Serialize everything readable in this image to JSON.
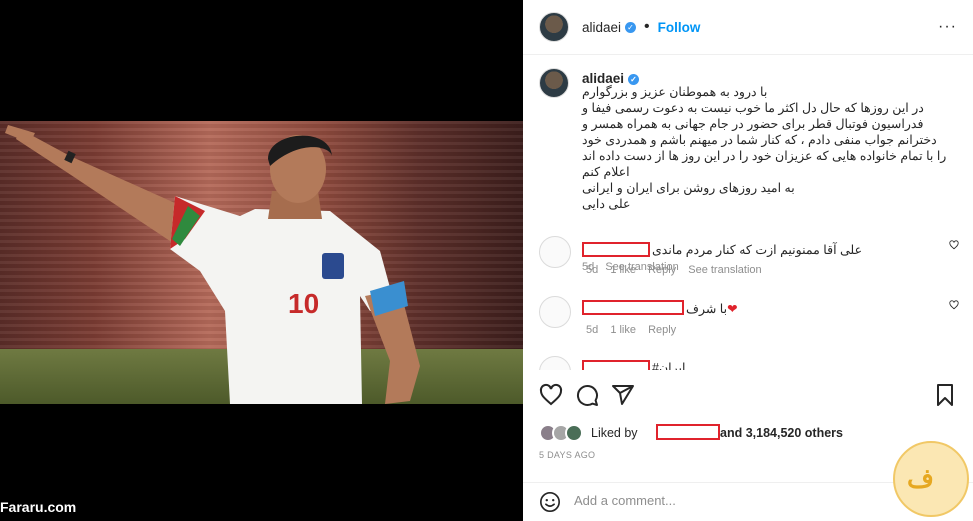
{
  "media": {
    "watermark": "Fararu.com",
    "jersey_number": "10"
  },
  "header": {
    "username": "alidaei",
    "separator": "•",
    "follow_label": "Follow",
    "more_label": "···"
  },
  "caption": {
    "username": "alidaei",
    "lines": [
      "با درود به هموطنان عزیز و بزرگوارم",
      "در این روزها که حال دل اکثر ما خوب نیست به دعوت رسمی فیفا و",
      "فدراسیون فوتبال قطر برای حضور در جام جهانی به همراه همسر و",
      "دخترانم جواب منفی دادم ، که کنار شما در میهنم باشم و همدردی خود",
      "را با تمام خانواده هایی که عزیزان خود را در این روز ها از دست داده اند",
      "اعلام کنم",
      "به امید روزهای روشن برای ایران و ایرانی",
      "علی دایی"
    ],
    "age": "5d",
    "see_translation": "See translation"
  },
  "comments": [
    {
      "text": "علی آقا ممنونیم ازت که کنار مردم ماندی",
      "age": "5d",
      "likes": "1 like",
      "reply": "Reply",
      "see_translation": "See translation"
    },
    {
      "text": "با شرف",
      "age": "5d",
      "likes": "1 like",
      "reply": "Reply"
    },
    {
      "text": "#ایران"
    }
  ],
  "likes": {
    "prefix": "Liked by",
    "suffix": "and 3,184,520 others"
  },
  "time_ago": "5 DAYS AGO",
  "add_comment": {
    "placeholder": "Add a comment..."
  },
  "colors": {
    "accent": "#0095f6",
    "redaction": "#e0232c",
    "heart": "#e0232c"
  }
}
